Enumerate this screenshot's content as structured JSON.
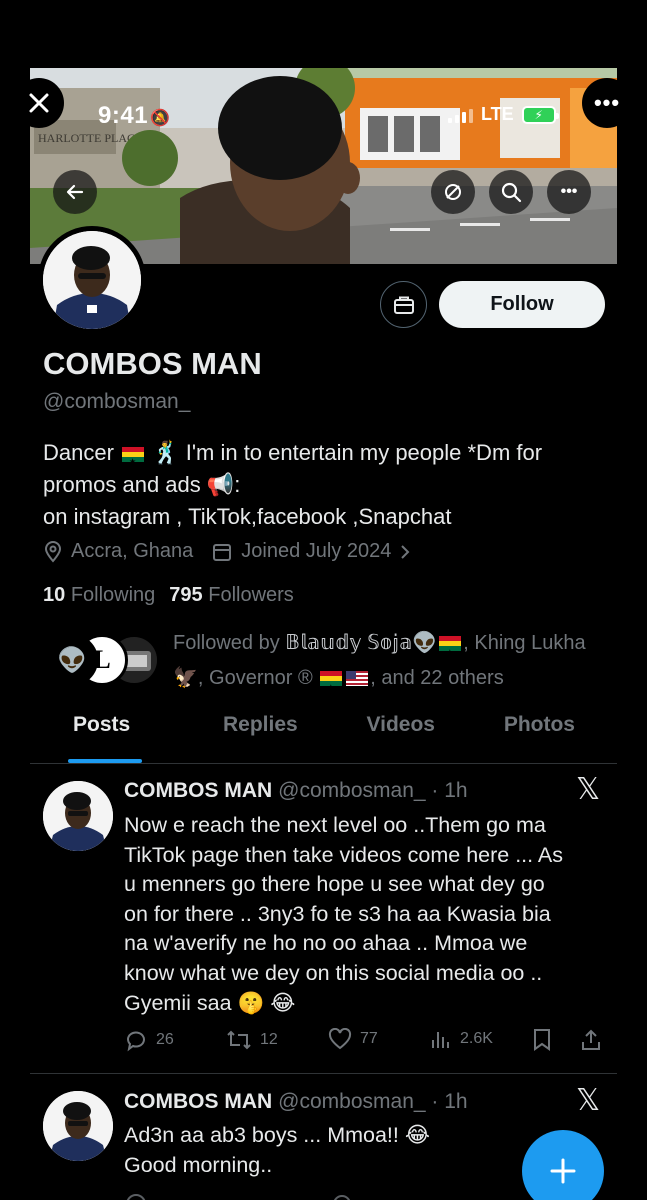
{
  "status": {
    "time": "9:41",
    "network": "LTE"
  },
  "banner": {
    "sign_text": "HARLOTTE PLACE"
  },
  "profile": {
    "name": "COMBOS MAN",
    "handle": "@combosman_",
    "follow_label": "Follow",
    "bio_line1_a": "Dancer",
    "bio_line1_b": "I'm in to entertain my people *Dm for",
    "bio_line2": "promos and ads",
    "bio_line3": "on instagram , TikTok,facebook ,Snapchat",
    "location": "Accra, Ghana",
    "joined": "Joined July 2024",
    "following_count": "10",
    "following_label": "Following",
    "followers_count": "795",
    "followers_label": "Followers",
    "followed_by_prefix": "Followed by",
    "followed_by_1": "𝔹𝕝𝕒𝕦𝕕𝕪 𝕊𝕠𝕛𝕒",
    "followed_by_2": ", Khing Lukha",
    "followed_by_3": ", Governor",
    "followed_by_suffix": ", and 22 others"
  },
  "tabs": [
    {
      "label": "Posts",
      "active": true
    },
    {
      "label": "Replies",
      "active": false
    },
    {
      "label": "Videos",
      "active": false
    },
    {
      "label": "Photos",
      "active": false
    }
  ],
  "posts": [
    {
      "name": "COMBOS MAN",
      "handle": "@combosman_ · 1h",
      "lines": [
        "Now e reach the next level oo ..Them go ma",
        "TikTok page then take videos come here ... As",
        "u menners go there hope u see what dey go",
        "on for there .. 3ny3 fo te s3 ha aa Kwasia bia",
        "na w'averify ne ho no oo ahaa .. Mmoa we",
        "know what we dey on this social media oo ..",
        "Gyemii saa"
      ],
      "replies": "26",
      "reposts": "12",
      "likes": "77",
      "views": "2.6K"
    },
    {
      "name": "COMBOS MAN",
      "handle": "@combosman_ · 1h",
      "lines": [
        "Ad3n aa ab3 boys ... Mmoa!!",
        "Good morning.."
      ]
    }
  ],
  "colors": {
    "accent": "#1d9bf0",
    "muted": "#71767b",
    "text": "#e7e9ea",
    "divider": "#2f3336"
  },
  "icons": [
    "close-icon",
    "more-icon",
    "back-icon",
    "hide-icon",
    "search-icon",
    "briefcase-icon",
    "location-icon",
    "calendar-icon",
    "reply-icon",
    "repost-icon",
    "like-icon",
    "views-icon",
    "bookmark-icon",
    "share-icon",
    "compose-icon"
  ]
}
